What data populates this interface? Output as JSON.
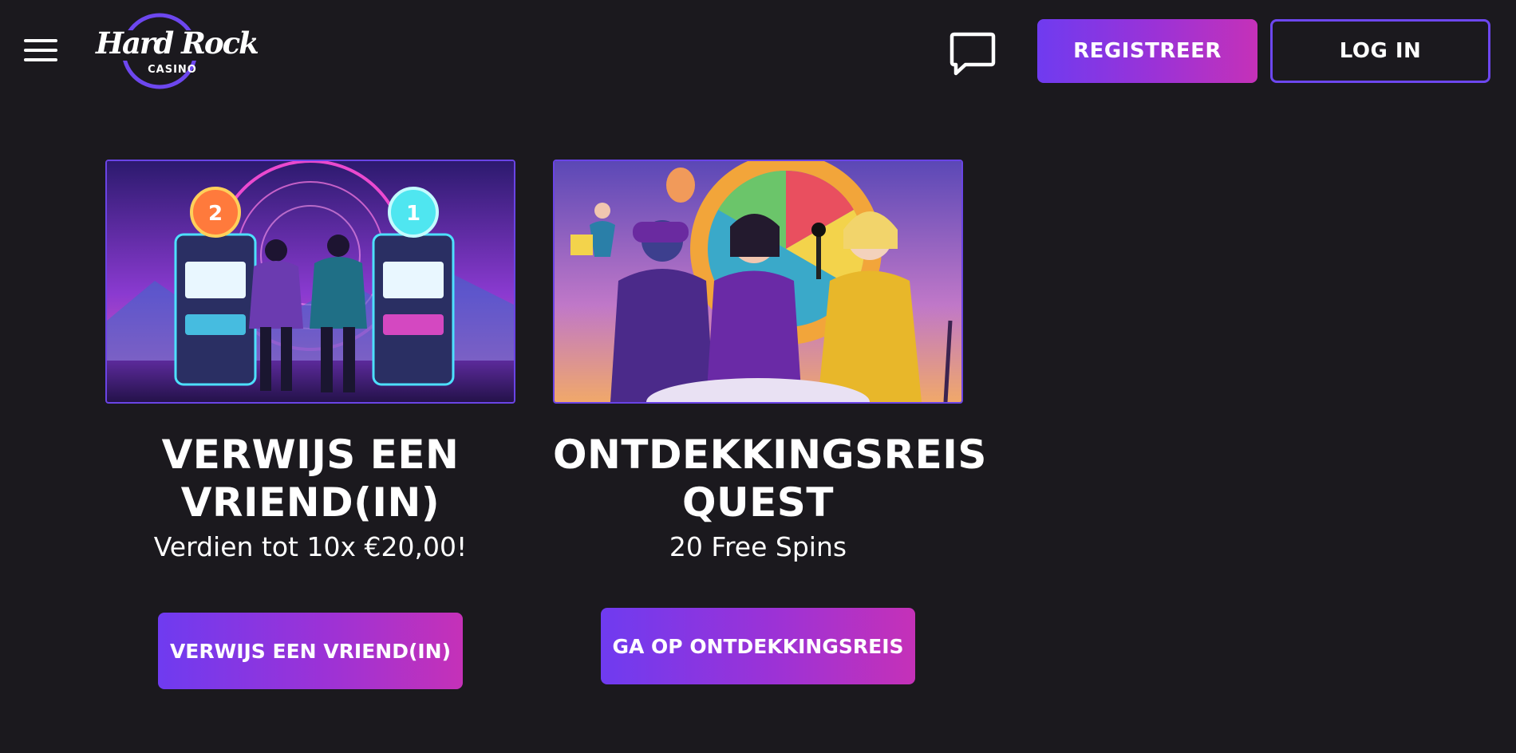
{
  "header": {
    "logo": {
      "brand": "Hard Rock",
      "sub": "CASINO"
    },
    "menu_icon": "hamburger-menu-icon",
    "chat_icon": "chat-bubble-icon",
    "register_label": "REGISTREER",
    "login_label": "LOG IN"
  },
  "promotions": [
    {
      "image_alt": "Two people in hoodies standing between neon slot machines",
      "title": "VERWIJS EEN VRIEND(IN)",
      "subtitle": "Verdien tot 10x €20,00!",
      "cta_label": "VERWIJS EEN VRIEND(IN)"
    },
    {
      "image_alt": "Fantasy characters in front of a colourful prize wheel",
      "title": "ONTDEKKINGSREIS QUEST",
      "subtitle": "20 Free Spins",
      "cta_label": "GA OP ONTDEKKINGSREIS"
    }
  ],
  "colors": {
    "background": "#1b191e",
    "accent_purple": "#6d47ef",
    "gradient_start": "#6f3bf0",
    "gradient_end": "#c531b8"
  }
}
